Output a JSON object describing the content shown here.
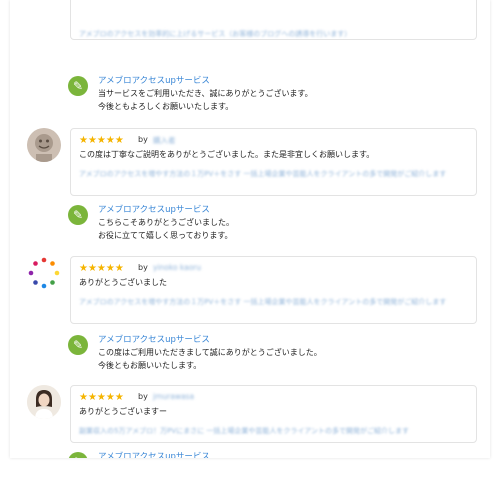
{
  "service_name": "アメブロアクセスupサービス",
  "top_blurred_text": "アメブロのアクセスを効率的に上げるサービス（お客様のブログへの誘導を行います）",
  "replies": [
    {
      "name": "アメブロアクセスupサービス",
      "lines": [
        "当サービスをご利用いただき、誠にありがとうございます。",
        "今後ともよろしくお願いいたします。"
      ]
    },
    {
      "name": "アメブロアクセスupサービス",
      "lines": [
        "こちらこそありがとうございました。",
        "お役に立てて嬉しく思っております。"
      ]
    },
    {
      "name": "アメブロアクセスupサービス",
      "lines": [
        "この度はご利用いただきまして誠にありがとうございました。",
        "今後ともお願いいたします。"
      ]
    },
    {
      "name": "アメブロアクセスupサービス",
      "lines": []
    }
  ],
  "reviews": [
    {
      "stars": "★★★★★",
      "by": "by",
      "user": "購入者",
      "comment": "この度は丁寧なご説明をありがとうございました。また是非宜しくお願いします。",
      "blurred": "アメブロのアクセスを増やす方法の１万PV＋をさす 一括上場企業や芸能人をクライアントの多で開発がご紹介します"
    },
    {
      "stars": "★★★★★",
      "by": "by",
      "user": "yinoko kaoru",
      "comment": "ありがとうございました",
      "blurred": "アメブロのアクセスを増やす方法の１万PV＋をさす 一括上場企業や芸能人をクライアントの多で開発がご紹介します"
    },
    {
      "stars": "★★★★★",
      "by": "by",
      "user": "jmurawasa",
      "comment": "ありがとうございますー",
      "blurred": "副業収入の5万アメブロ！万PVにまさに 一括上場企業や芸能人をクライアントの多で開発がご紹介します"
    }
  ]
}
